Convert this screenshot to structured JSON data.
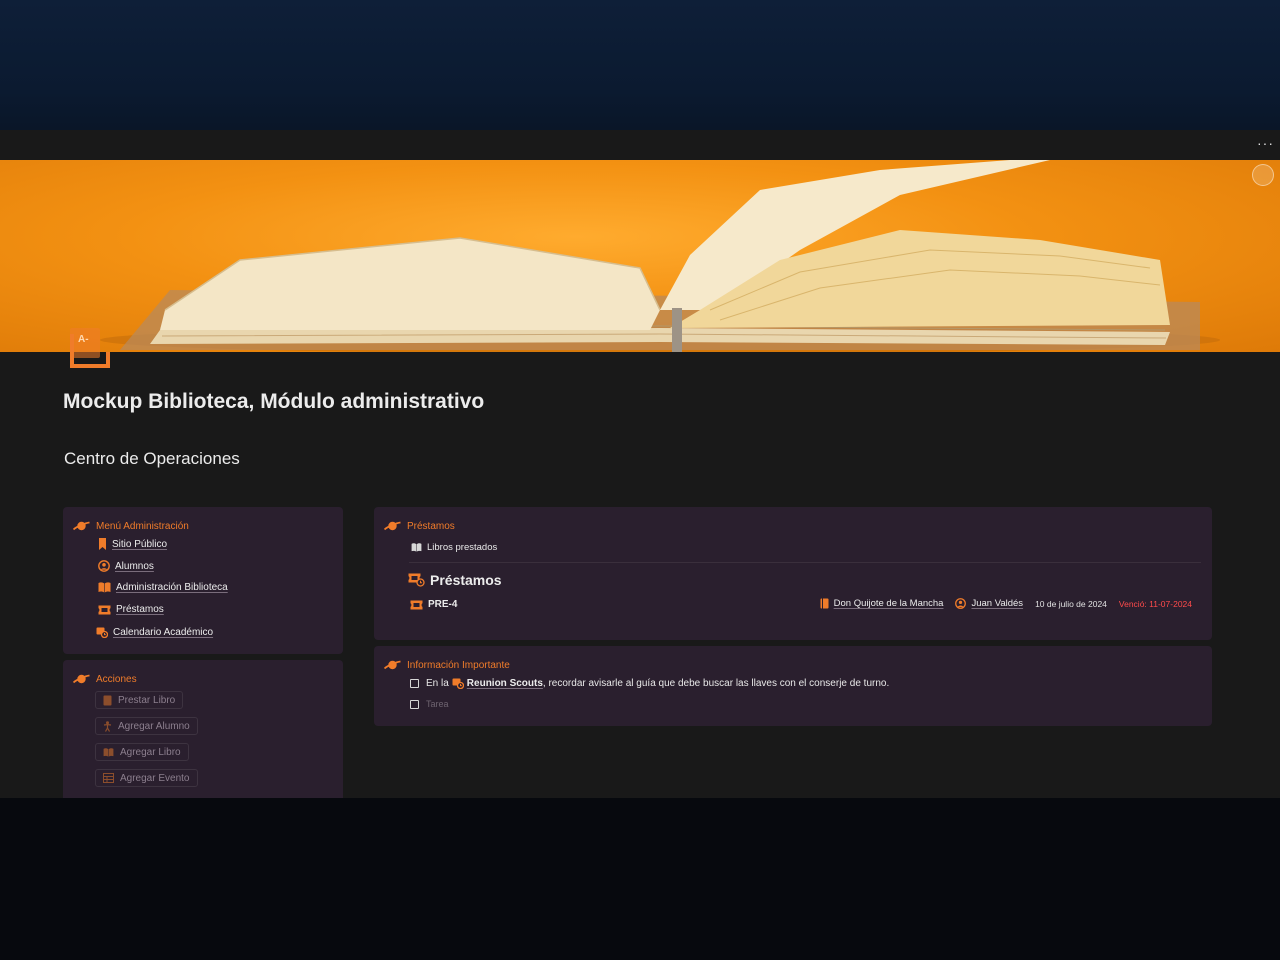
{
  "page": {
    "title": "Mockup Biblioteca, Módulo administrativo"
  },
  "toolbar": {
    "more_label": "···"
  },
  "section": {
    "heading": "Centro de Operaciones"
  },
  "menu": {
    "title": "Menú Administración",
    "items": [
      {
        "label": "Sitio Público",
        "icon": "bookmark-icon"
      },
      {
        "label": "Alumnos",
        "icon": "user-circle-icon"
      },
      {
        "label": "Administración Biblioteca",
        "icon": "open-book-icon"
      },
      {
        "label": "Préstamos",
        "icon": "ticket-icon"
      },
      {
        "label": "Calendario Académico",
        "icon": "calendar-clock-icon"
      }
    ]
  },
  "actions": {
    "title": "Acciones",
    "buttons": [
      {
        "label": "Prestar Libro",
        "icon": "book-icon"
      },
      {
        "label": "Agregar Alumno",
        "icon": "person-icon"
      },
      {
        "label": "Agregar Libro",
        "icon": "open-book-icon"
      },
      {
        "label": "Agregar Evento",
        "icon": "table-icon"
      }
    ]
  },
  "loans": {
    "title": "Préstamos",
    "view_tab": "Libros prestados",
    "db_title": "Préstamos",
    "row": {
      "id": "PRE-4",
      "book": "Don Quijote de la Mancha",
      "student": "Juan Valdés",
      "date": "10 de julio de 2024",
      "status": "Venció: 11-07-2024"
    }
  },
  "info": {
    "title": "Información Importante",
    "todo_prefix": "En la",
    "todo_link": "Reunion Scouts",
    "todo_suffix": ", recordar avisarle al guía que debe buscar las llaves con el conserje de turno.",
    "todo_placeholder": "Tarea"
  },
  "colors": {
    "accent": "#f07c2a",
    "callout_bg": "#2a1f2e",
    "overdue": "#ff4b4b",
    "page_bg": "#191919"
  }
}
